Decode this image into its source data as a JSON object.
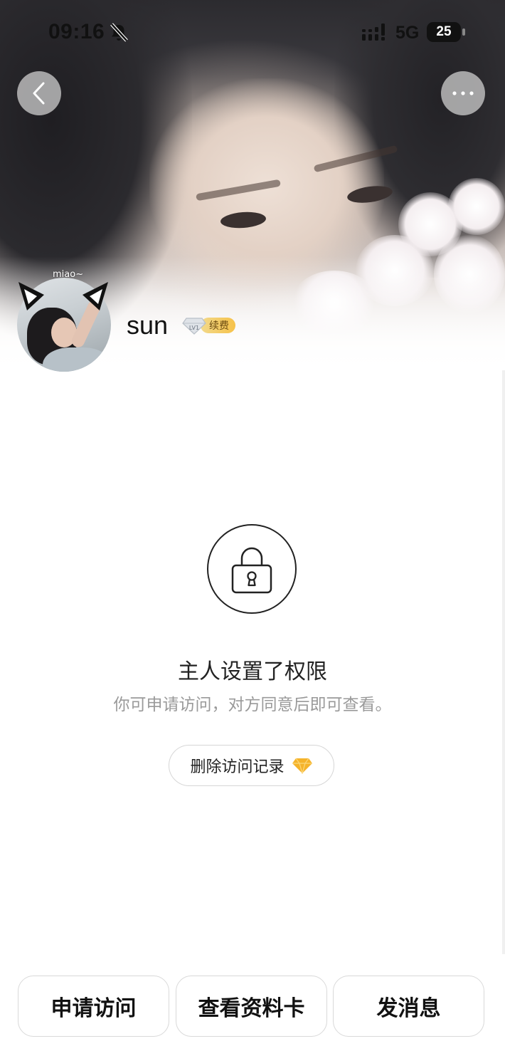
{
  "status_bar": {
    "time": "09:16",
    "network": "5G",
    "battery": "25"
  },
  "header": {
    "back_icon": "chevron-left-icon",
    "more_icon": "ellipsis-icon"
  },
  "profile": {
    "avatar_caption": "miao~",
    "username": "sun",
    "vip_level": "LV1",
    "vip_action": "续费"
  },
  "locked": {
    "icon": "lock-icon",
    "title": "主人设置了权限",
    "description": "你可申请访问，对方同意后即可查看。",
    "delete_button_label": "删除访问记录",
    "delete_button_icon": "diamond-icon"
  },
  "bottom_actions": [
    {
      "label": "申请访问"
    },
    {
      "label": "查看资料卡"
    },
    {
      "label": "发消息"
    }
  ],
  "colors": {
    "text_primary": "#222222",
    "text_secondary": "#9a9a9a",
    "border": "#d9d9d9",
    "vip_gold": "#f6c24a",
    "diamond": "#f5b32a"
  }
}
